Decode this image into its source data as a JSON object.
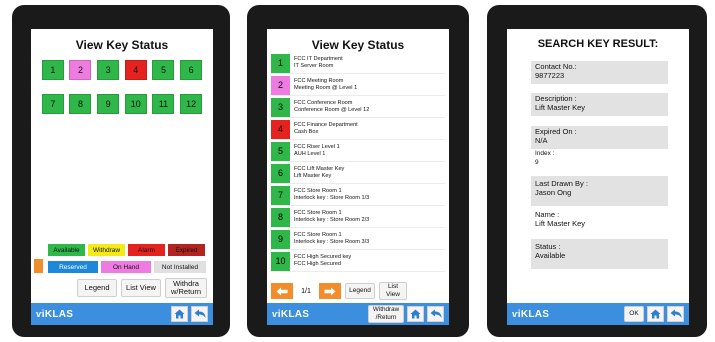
{
  "colors": {
    "green": "#2fb74a",
    "pink": "#ee7ce0",
    "red": "#e4231f",
    "footer_blue": "#3b8fde",
    "orange": "#f28d2b",
    "legend_available": "#2fb74a",
    "legend_withdraw": "#f4ea18",
    "legend_alarm": "#e4231f",
    "legend_expired": "#b3231f",
    "legend_reserved": "#1e88d8",
    "legend_onhand": "#ee7ce0",
    "legend_notinstalled": "#e0e0e0"
  },
  "screen1": {
    "title": "View Key Status",
    "keys": [
      {
        "num": "1",
        "status": "green"
      },
      {
        "num": "2",
        "status": "pink"
      },
      {
        "num": "3",
        "status": "green"
      },
      {
        "num": "4",
        "status": "red"
      },
      {
        "num": "5",
        "status": "green"
      },
      {
        "num": "6",
        "status": "green"
      },
      {
        "num": "7",
        "status": "green"
      },
      {
        "num": "8",
        "status": "green"
      },
      {
        "num": "9",
        "status": "green"
      },
      {
        "num": "10",
        "status": "green"
      },
      {
        "num": "11",
        "status": "green"
      },
      {
        "num": "12",
        "status": "green"
      }
    ],
    "legend_row1": [
      {
        "label": "Available",
        "color": "legend_available"
      },
      {
        "label": "Withdraw",
        "color": "legend_withdraw"
      },
      {
        "label": "Alarm",
        "color": "legend_alarm"
      },
      {
        "label": "Expired",
        "color": "legend_expired"
      }
    ],
    "legend_row2": [
      {
        "label": "Reserved",
        "color": "legend_reserved"
      },
      {
        "label": "On Hand",
        "color": "legend_onhand"
      },
      {
        "label": "Not Installed",
        "color": "legend_notinstalled"
      }
    ],
    "buttons": {
      "legend": "Legend",
      "list_view": "List View",
      "withdraw_line1": "Withdra",
      "withdraw_line2": "w/Return"
    },
    "logo": "iKLAS",
    "icons": [
      "home-icon",
      "back-arrow-icon"
    ]
  },
  "screen2": {
    "title": "View Key Status",
    "items": [
      {
        "num": "1",
        "status": "green",
        "line1": "FCC IT Department",
        "line2": "IT Server Room"
      },
      {
        "num": "2",
        "status": "pink",
        "line1": "FCC Meeting Room",
        "line2": "Meeting Room @ Level 1"
      },
      {
        "num": "3",
        "status": "green",
        "line1": "FCC Conference Room",
        "line2": "Conference Room @ Level 12"
      },
      {
        "num": "4",
        "status": "red",
        "line1": "FCC Finance Department",
        "line2": "Cash Box"
      },
      {
        "num": "5",
        "status": "green",
        "line1": "FCC Riser Level 1",
        "line2": "AUH Level 1"
      },
      {
        "num": "6",
        "status": "green",
        "line1": "FCC Lift Master Key",
        "line2": "Lift Master Key"
      },
      {
        "num": "7",
        "status": "green",
        "line1": "FCC Store Room 1",
        "line2": "Interlock key : Store Room 1/3"
      },
      {
        "num": "8",
        "status": "green",
        "line1": "FCC Store Room 1",
        "line2": "Interlock key : Store Room 2/3"
      },
      {
        "num": "9",
        "status": "green",
        "line1": "FCC Store Room 1",
        "line2": "Interlock key : Store Room 3/3"
      },
      {
        "num": "10",
        "status": "green",
        "line1": "FCC High Secured key",
        "line2": "FCC High Secured"
      }
    ],
    "page_indicator": "1/1",
    "buttons": {
      "legend": "Legend",
      "list_view_line1": "List",
      "list_view_line2": "View",
      "withdraw_line1": "Withdraw",
      "withdraw_line2": "/Return"
    },
    "logo": "iKLAS"
  },
  "screen3": {
    "title": "SEARCH KEY RESULT:",
    "contact_label": "Contact No.:",
    "contact_value": "9877223",
    "description_label": "Description :",
    "description_value": "Lift Master Key",
    "expired_label": "Expired On :",
    "expired_value": "N/A",
    "index_label": "Index :",
    "index_value": "9",
    "drawn_label": "Last Drawn By :",
    "drawn_value": "Jason Ong",
    "name_label": "Name :",
    "name_value": "Lift Master Key",
    "status_label": "Status :",
    "status_value": "Available",
    "ok_label": "OK",
    "logo": "iKLAS"
  }
}
